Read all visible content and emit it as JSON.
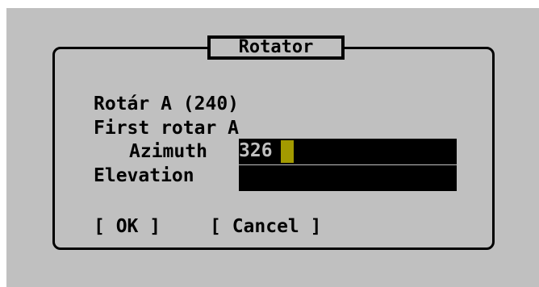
{
  "dialog": {
    "title": "Rotator",
    "line1": "Rotár A (240)",
    "line2": "First rotar A"
  },
  "azimuth": {
    "label": "Azimuth",
    "value": "326"
  },
  "elevation": {
    "label": "Elevation",
    "value": ""
  },
  "buttons": {
    "ok": "[ OK ]",
    "cancel": "[ Cancel ]"
  },
  "colors": {
    "background": "#c0c0c0",
    "field_bg": "#000000",
    "field_text": "#c0c0c0",
    "cursor": "#a39a00"
  }
}
